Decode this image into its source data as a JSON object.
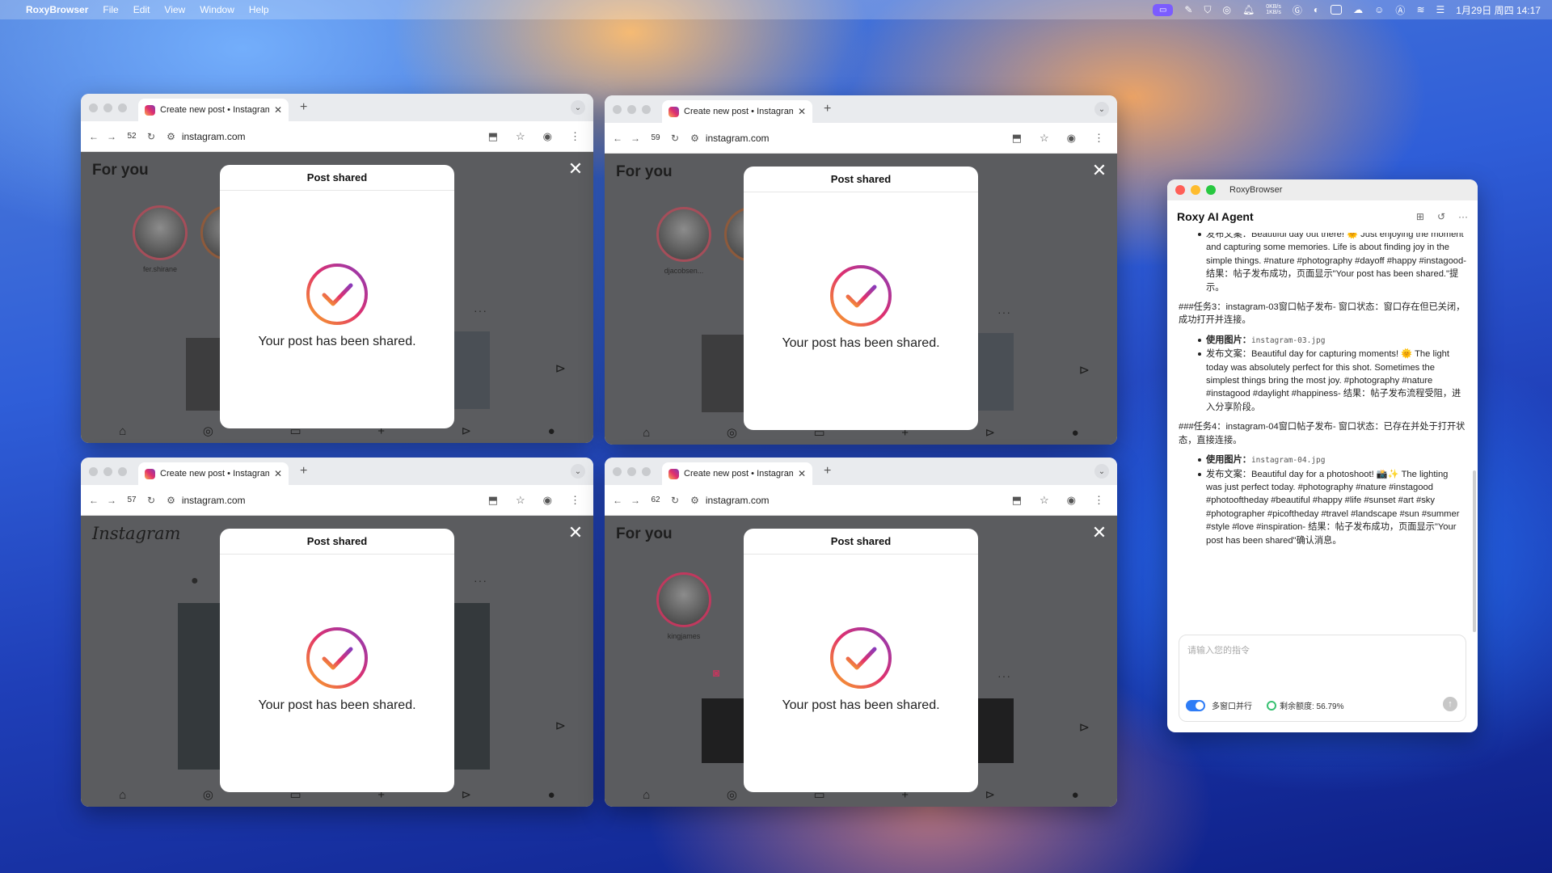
{
  "menubar": {
    "app": "RoxyBrowser",
    "items": [
      "File",
      "Edit",
      "View",
      "Window",
      "Help"
    ],
    "net_up": "0KB/s",
    "net_down": "1KB/s",
    "datetime": "1月29日 周四 14:17"
  },
  "browsers": [
    {
      "tab_title": "Create new post • Instagram",
      "tab_number": "52",
      "url": "instagram.com",
      "header": "For you",
      "header_kind": "text",
      "story_name": "fer.shirane",
      "modal_title": "Post shared",
      "modal_message": "Your post has been shared."
    },
    {
      "tab_title": "Create new post • Instagram",
      "tab_number": "59",
      "url": "instagram.com",
      "header": "For you",
      "header_kind": "text",
      "story_name": "djacobsen...",
      "modal_title": "Post shared",
      "modal_message": "Your post has been shared."
    },
    {
      "tab_title": "Create new post • Instagram",
      "tab_number": "57",
      "url": "instagram.com",
      "header": "Instagram",
      "header_kind": "logo",
      "story_name": "",
      "modal_title": "Post shared",
      "modal_message": "Your post has been shared."
    },
    {
      "tab_title": "Create new post • Instagram",
      "tab_number": "62",
      "url": "instagram.com",
      "header": "For you",
      "header_kind": "text",
      "story_name": "kingjames",
      "modal_title": "Post shared",
      "modal_message": "Your post has been shared."
    }
  ],
  "agent": {
    "window_title": "RoxyBrowser",
    "title": "Roxy AI Agent",
    "blocks": {
      "task2_caption": "发布文案：Beautiful day out there! 🌞 Just enjoying the moment and capturing some memories. Life is about finding joy in the simple things. #nature #photography #dayoff #happy #instagood- 结果：帖子发布成功，页面显示\"Your post has been shared.\"提示。",
      "task3_header": "###任务3：instagram-03窗口帖子发布- 窗口状态：窗口存在但已关闭，成功打开并连接。",
      "task3_image_label": "使用图片：",
      "task3_image": "instagram-03.jpg",
      "task3_caption": "发布文案：Beautiful day for capturing moments! 🌞 The light today was absolutely perfect for this shot. Sometimes the simplest things bring the most joy. #photography #nature #instagood #daylight #happiness- 结果：帖子发布流程受阻，进入分享阶段。",
      "task4_header": "###任务4：instagram-04窗口帖子发布- 窗口状态：已存在并处于打开状态，直接连接。",
      "task4_image_label": "使用图片：",
      "task4_image": "instagram-04.jpg",
      "task4_caption": "发布文案：Beautiful day for a photoshoot! 📸✨ The lighting was just perfect today. #photography #nature #instagood #photooftheday #beautiful #happy #life #sunset #art #sky #photographer #picoftheday #travel #landscape #sun #summer #style #love #inspiration- 结果：帖子发布成功，页面显示\"Your post has been shared\"确认消息。"
    },
    "input_placeholder": "请输入您的指令",
    "toggle_label": "多窗口并行",
    "quota_label": "剩余额度: 56.79%"
  },
  "colors": {
    "check_start": "#f9a825",
    "check_mid": "#e1306c",
    "check_end": "#8a3ab9",
    "toggle": "#2e7cf6"
  }
}
